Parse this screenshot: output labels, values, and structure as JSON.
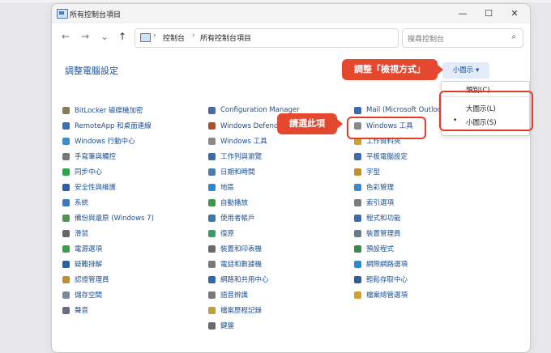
{
  "window": {
    "title": "所有控制台項目",
    "min": "—",
    "max": "☐",
    "close": "✕"
  },
  "nav": {
    "back": "←",
    "forward": "→",
    "recent": "⌄",
    "up": "↑",
    "crumb1": "控制台",
    "crumb2": "所有控制台項目",
    "sep": "›",
    "dropdown": "⌄",
    "refresh": "↻",
    "search_placeholder": "搜尋控制台",
    "search_icon": "⌕"
  },
  "main": {
    "heading": "調整電腦設定",
    "view_by_label": "小圖示 ▾",
    "star": "☆"
  },
  "dropdown": {
    "category": "類別(C)",
    "large": "大圖示(L)",
    "small": "小圖示(S)",
    "bullet": "•"
  },
  "callouts": {
    "view_mode": "調整「檢視方式」",
    "select_item": "請選此項"
  },
  "columns": {
    "col1": [
      {
        "label": "BitLocker 磁碟機加密",
        "icon": "bitlocker-icon",
        "color": "#8a7a5a"
      },
      {
        "label": "RemoteApp 和桌面連線",
        "icon": "remoteapp-icon",
        "color": "#3a6fb0"
      },
      {
        "label": "Windows 行動中心",
        "icon": "mobility-icon",
        "color": "#3a8fd0"
      },
      {
        "label": "手寫筆與觸控",
        "icon": "pen-icon",
        "color": "#777777"
      },
      {
        "label": "同步中心",
        "icon": "sync-icon",
        "color": "#2aa84a"
      },
      {
        "label": "安全性與維護",
        "icon": "flag-icon",
        "color": "#2a5fb0"
      },
      {
        "label": "系統",
        "icon": "system-icon",
        "color": "#3a7ac0"
      },
      {
        "label": "備份與還原 (Windows 7)",
        "icon": "backup-icon",
        "color": "#4a9a4a"
      },
      {
        "label": "滑鼠",
        "icon": "mouse-icon",
        "color": "#666666"
      },
      {
        "label": "電源選項",
        "icon": "power-icon",
        "color": "#3aa04a"
      },
      {
        "label": "疑難排解",
        "icon": "troubleshoot-icon",
        "color": "#2a5fa0"
      },
      {
        "label": "認證管理員",
        "icon": "credential-icon",
        "color": "#c0902a"
      },
      {
        "label": "儲存空間",
        "icon": "storage-icon",
        "color": "#7a8a9a"
      },
      {
        "label": "聲音",
        "icon": "sound-icon",
        "color": "#6a6a8a"
      }
    ],
    "col2": [
      {
        "label": "Configuration Manager",
        "icon": "config-icon",
        "color": "#4a6aa0"
      },
      {
        "label": "Windows Defender 防火牆",
        "icon": "firewall-icon",
        "color": "#b0502a"
      },
      {
        "label": "Windows 工具",
        "icon": "tools-icon",
        "color": "#8a8a8a"
      },
      {
        "label": "工作列與瀏覽",
        "icon": "taskbar-icon",
        "color": "#3a6ab0"
      },
      {
        "label": "日期和時間",
        "icon": "clock-icon",
        "color": "#4a7ab0"
      },
      {
        "label": "地區",
        "icon": "region-icon",
        "color": "#2a8ad0"
      },
      {
        "label": "自動播放",
        "icon": "autoplay-icon",
        "color": "#3a9a4a"
      },
      {
        "label": "使用者帳戶",
        "icon": "users-icon",
        "color": "#3a7ab0"
      },
      {
        "label": "復原",
        "icon": "recovery-icon",
        "color": "#3a9a6a"
      },
      {
        "label": "裝置和印表機",
        "icon": "printer-icon",
        "color": "#6a6a6a"
      },
      {
        "label": "電話和數據機",
        "icon": "phone-icon",
        "color": "#7a7a7a"
      },
      {
        "label": "網路和共用中心",
        "icon": "network-icon",
        "color": "#2a6ab0"
      },
      {
        "label": "語音辨識",
        "icon": "mic-icon",
        "color": "#7a7a7a"
      },
      {
        "label": "檔案歷程記錄",
        "icon": "history-icon",
        "color": "#c0a030"
      },
      {
        "label": "鍵盤",
        "icon": "keyboard-icon",
        "color": "#6a6a6a"
      }
    ],
    "col3": [
      {
        "label": "Mail (Microsoft Outlook)",
        "icon": "mail-icon",
        "color": "#3a6ab0"
      },
      {
        "label": "Windows 工具",
        "icon": "tools-icon",
        "color": "#8a8a8a"
      },
      {
        "label": "工作資料夾",
        "icon": "folder-icon",
        "color": "#d0a030"
      },
      {
        "label": "平板電腦設定",
        "icon": "tablet-icon",
        "color": "#3a6ab0"
      },
      {
        "label": "字型",
        "icon": "font-icon",
        "color": "#c0902a"
      },
      {
        "label": "色彩管理",
        "icon": "color-icon",
        "color": "#3a8ad0"
      },
      {
        "label": "索引選項",
        "icon": "index-icon",
        "color": "#7a7a7a"
      },
      {
        "label": "程式和功能",
        "icon": "programs-icon",
        "color": "#3a6ab0"
      },
      {
        "label": "裝置管理員",
        "icon": "device-icon",
        "color": "#6a7a8a"
      },
      {
        "label": "預設程式",
        "icon": "default-icon",
        "color": "#3a8a4a"
      },
      {
        "label": "網際網路選項",
        "icon": "internet-icon",
        "color": "#2a8ad0"
      },
      {
        "label": "輕鬆存取中心",
        "icon": "access-icon",
        "color": "#2a5fa0"
      },
      {
        "label": "檔案總管選項",
        "icon": "explorer-icon",
        "color": "#d0a030"
      }
    ]
  },
  "accent": "#e4492f"
}
